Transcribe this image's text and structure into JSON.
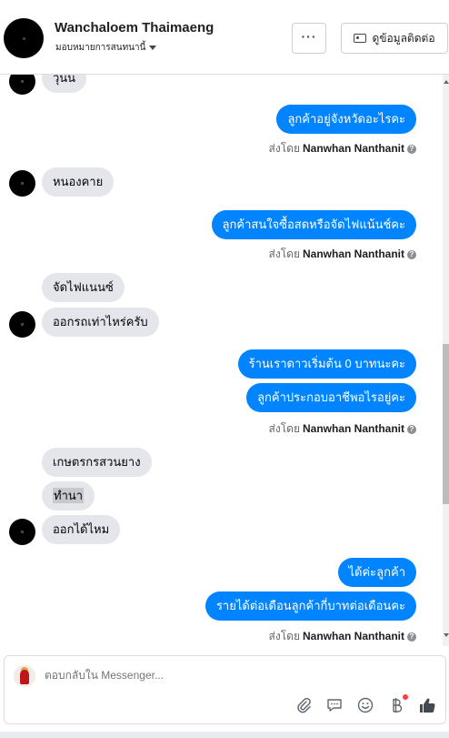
{
  "header": {
    "name": "Wanchaloem Thaimaeng",
    "assign_label": "มอบหมายการสนทนานี้",
    "more_label": "···",
    "contact_label": "ดูข้อมูลติดต่อ"
  },
  "messages": {
    "m0": "วุ้นน",
    "m1": "ลูกค้าอยู่จังหวัดอะไรคะ",
    "m2": "หนองคาย",
    "m3": "ลูกค้าสนใจซื้อสดหรือจัดไฟแน้นช์คะ",
    "m4": "จัดไฟแนนซ์",
    "m5": "ออกรถเท่าไหร่ครับ",
    "m6": "ร้านเราดาวเริ่มต้น 0 บาทนะคะ",
    "m7": "ลูกค้าประกอบอาชีพอไรอยู่คะ",
    "m8": "เกษตรกรสวนยาง",
    "m9": "ทำนา",
    "m10": "ออกได้ไหม",
    "m11": "ได้ค่ะลูกค้า",
    "m12": "รายได้ต่อเดือนลูกค้ากี่บาทต่อเดือนคะ"
  },
  "sent_by": {
    "prefix": "ส่งโดย",
    "agent": "Nanwhan Nanthanit",
    "info": "?"
  },
  "composer": {
    "placeholder": "ตอบกลับใน Messenger..."
  },
  "colors": {
    "outgoing": "#0084ff",
    "incoming": "#e4e6eb",
    "like": "#444950"
  },
  "icons": [
    "attach-icon",
    "reply-icon",
    "emoji-icon",
    "payment-icon",
    "thumbs-up-icon"
  ]
}
